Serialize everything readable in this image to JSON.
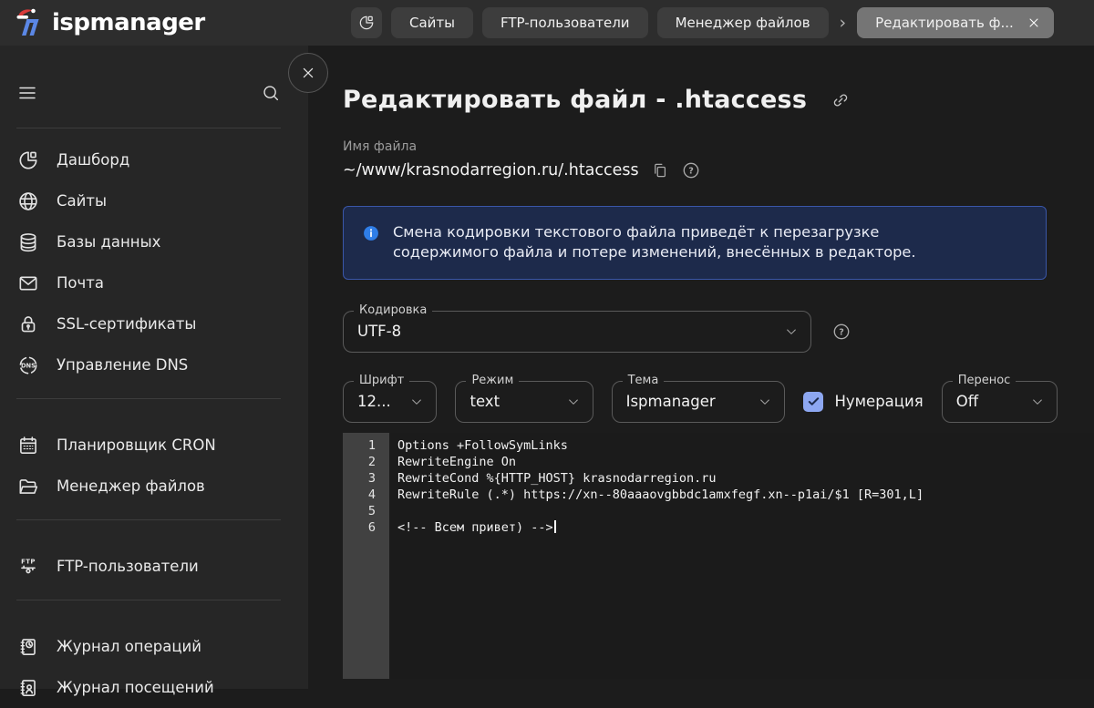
{
  "topbar": {
    "logo_text": "ispmanager",
    "tabs": [
      {
        "label": "Сайты",
        "active": false,
        "separator_before": false,
        "closable": false
      },
      {
        "label": "FTP-пользователи",
        "active": false,
        "separator_before": false,
        "closable": false
      },
      {
        "label": "Менеджер файлов",
        "active": false,
        "separator_before": false,
        "closable": false
      },
      {
        "label": "Редактировать ф...",
        "active": true,
        "separator_before": true,
        "closable": true
      }
    ]
  },
  "sidebar": {
    "groups": [
      {
        "items": [
          {
            "icon": "dashboard-icon",
            "label": "Дашборд"
          },
          {
            "icon": "globe-icon",
            "label": "Сайты"
          },
          {
            "icon": "database-icon",
            "label": "Базы данных"
          },
          {
            "icon": "mail-icon",
            "label": "Почта"
          },
          {
            "icon": "ssl-lock-icon",
            "label": "SSL-сертификаты"
          },
          {
            "icon": "dns-icon",
            "label": "Управление DNS"
          }
        ]
      },
      {
        "items": [
          {
            "icon": "cron-calendar-icon",
            "label": "Планировщик CRON"
          },
          {
            "icon": "folder-icon",
            "label": "Менеджер файлов"
          }
        ]
      },
      {
        "items": [
          {
            "icon": "ftp-icon",
            "label": "FTP-пользователи"
          }
        ]
      },
      {
        "items": [
          {
            "icon": "journal-operations-icon",
            "label": "Журнал операций"
          },
          {
            "icon": "journal-visits-icon",
            "label": "Журнал посещений"
          }
        ]
      }
    ]
  },
  "main": {
    "title": "Редактировать файл - .htaccess",
    "file": {
      "label": "Имя файла",
      "value": "~/www/krasnodarregion.ru/.htaccess"
    },
    "banner": {
      "text": "Смена кодировки текстового файла приведёт к перезагрузке содержимого файла и потере изменений, внесённых в редакторе."
    },
    "encoding": {
      "label": "Кодировка",
      "value": "UTF-8"
    },
    "controls": {
      "font": {
        "label": "Шрифт",
        "value": "12..."
      },
      "mode": {
        "label": "Режим",
        "value": "text"
      },
      "theme": {
        "label": "Тема",
        "value": "Ispmanager"
      },
      "numbering": {
        "label": "Нумерация",
        "checked": true
      },
      "wrap": {
        "label": "Перенос",
        "value": "Off"
      }
    },
    "editor": {
      "lines": [
        {
          "num": 1,
          "text": "Options +FollowSymLinks"
        },
        {
          "num": 2,
          "text": "RewriteEngine On"
        },
        {
          "num": 3,
          "text": "RewriteCond %{HTTP_HOST} krasnodarregion.ru"
        },
        {
          "num": 4,
          "text": "RewriteRule (.*) https://xn--80aaaovgbbdc1amxfegf.xn--p1ai/$1 [R=301,L]"
        },
        {
          "num": 5,
          "text": ""
        },
        {
          "num": 6,
          "text": "<!-- Всем привет) -->",
          "cursor": true
        }
      ]
    }
  },
  "colors": {
    "topbar_bg": "#2d2d2d",
    "sidebar_bg": "#262626",
    "main_bg": "#1c1c1c",
    "tab_bg": "#3d3d3d",
    "tab_active_bg": "#757575",
    "banner_bg": "#1d2a4b",
    "banner_border": "#3a56a8",
    "info_blue": "#2f7ee8",
    "checkbox_blue": "#8da7f1",
    "gutter_bg": "#414141",
    "code_bg": "#1b1b1b",
    "logo_blue": "#5b87e5",
    "logo_red": "#d83a3a"
  }
}
